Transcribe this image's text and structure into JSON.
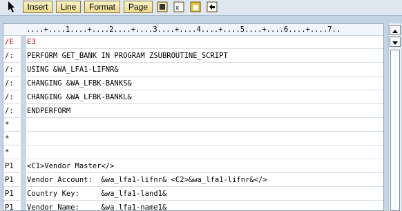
{
  "toolbar": {
    "buttons": [
      "Insert",
      "Line",
      "Format",
      "Page"
    ],
    "icons": [
      "select-cursor-icon",
      "copy-icon",
      "cut-icon",
      "paste-icon",
      "undo-icon"
    ]
  },
  "editor": {
    "ruler": "....+....1....+....2....+....3....+....4....+....5....+....6....+....7..",
    "rows": [
      {
        "format": "/E",
        "text": "E3",
        "red": true
      },
      {
        "format": "/:",
        "text": "PERFORM GET_BANK IN PROGRAM ZSUBROUTINE_SCRIPT"
      },
      {
        "format": "/:",
        "text": "USING &WA_LFA1-LIFNR&"
      },
      {
        "format": "/:",
        "text": "CHANGING &WA_LFBK-BANKS&"
      },
      {
        "format": "/:",
        "text": "CHANGING &WA_LFBK-BANKL&"
      },
      {
        "format": "/:",
        "text": "ENDPERFORM"
      },
      {
        "format": "*",
        "text": ""
      },
      {
        "format": "*",
        "text": ""
      },
      {
        "format": "*",
        "text": ""
      },
      {
        "format": "P1",
        "text": "<C1>Vendor Master</>"
      },
      {
        "format": "P1",
        "text": "Vendor Account:  &wa_lfa1-lifnr& <C2>&wa_lfa1-lifnr&</>"
      },
      {
        "format": "P1",
        "text": "Country Key:     &wa_lfa1-land1&"
      },
      {
        "format": "P1",
        "text": "Vendor Name:     &wa_lfa1-name1&"
      }
    ]
  },
  "scrollbar": {
    "up": "scroll-up-icon",
    "down": "scroll-down-icon"
  }
}
